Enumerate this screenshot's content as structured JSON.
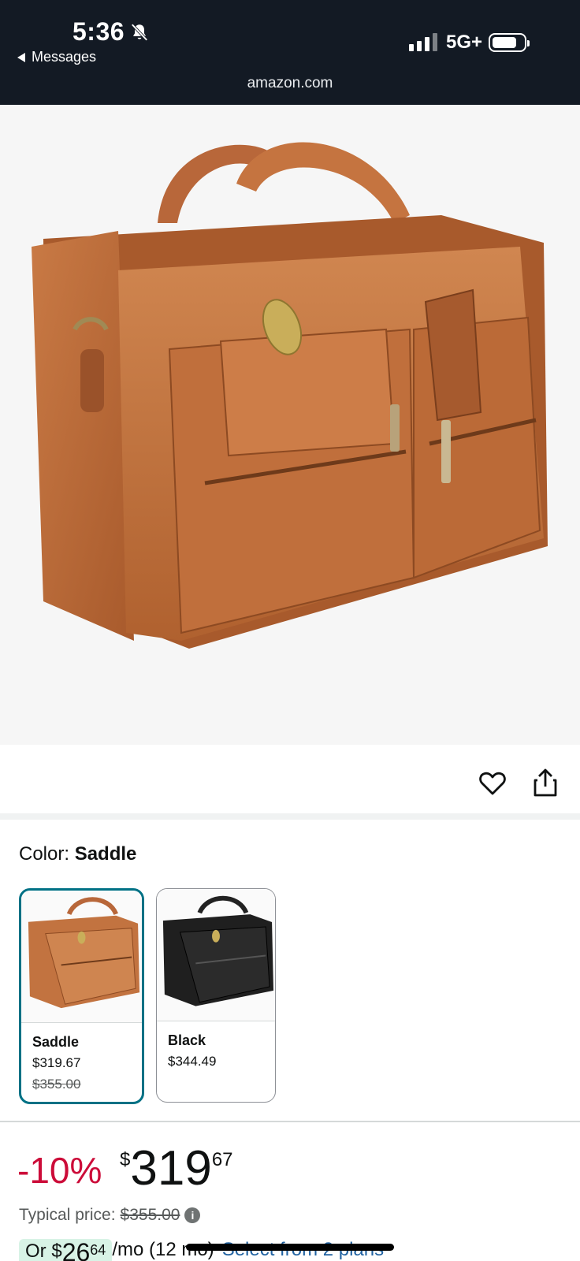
{
  "status_bar": {
    "time": "5:36",
    "back_app": "Messages",
    "network": "5G+",
    "url": "amazon.com"
  },
  "product": {
    "image_alt": "Saddle leather briefcase",
    "color_label": "Color:",
    "color_value": "Saddle"
  },
  "swatches": [
    {
      "name": "Saddle",
      "price": "$319.67",
      "original_price": "$355.00",
      "selected": true
    },
    {
      "name": "Black",
      "price": "$344.49",
      "original_price": "",
      "selected": false
    }
  ],
  "pricing": {
    "discount": "-10%",
    "currency": "$",
    "whole": "319",
    "fraction": "67",
    "typical_label": "Typical price:",
    "typical_price": "$355.00",
    "monthly_prefix": "Or $",
    "monthly_whole": "26",
    "monthly_fraction": "64",
    "monthly_suffix": "/mo (12 mo)",
    "plans_link": "Select from 2 plans"
  },
  "colors": {
    "status_bg": "#131a24",
    "selected_border": "#007185",
    "discount_red": "#cc0c39",
    "link_blue": "#2162a1",
    "saddle_leather": "#b96a3a"
  }
}
